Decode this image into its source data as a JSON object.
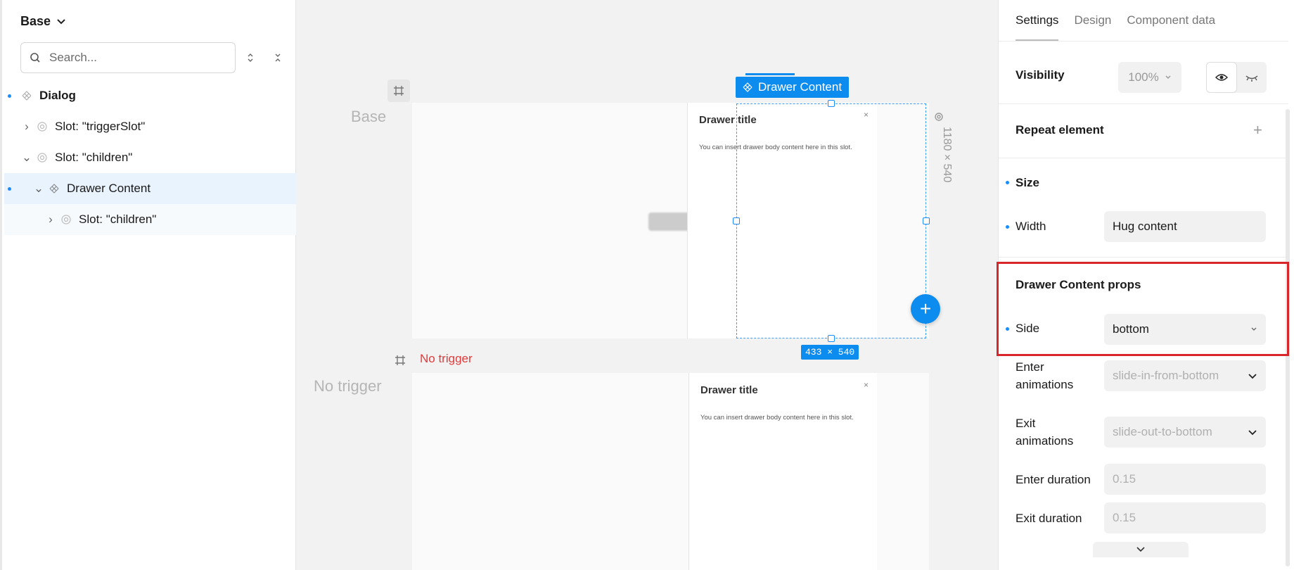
{
  "left_panel": {
    "variant": "Base",
    "search_placeholder": "Search...",
    "tree": [
      {
        "label": "Dialog"
      },
      {
        "label": "Slot: \"triggerSlot\""
      },
      {
        "label": "Slot: \"children\""
      },
      {
        "label": "Drawer Content"
      },
      {
        "label": "Slot: \"children\""
      }
    ]
  },
  "canvas": {
    "frames": [
      {
        "label": "Base"
      },
      {
        "label": "No trigger",
        "warning": "No trigger"
      }
    ],
    "selection_label": "Drawer Content",
    "selection_size": "433 × 540",
    "viewport_size": "1180 × 540",
    "drawer_title": "Drawer title",
    "drawer_body": "You can insert drawer body content here in this slot."
  },
  "right_panel": {
    "tabs": [
      "Settings",
      "Design",
      "Component data"
    ],
    "visibility": {
      "label": "Visibility",
      "opacity": "100%"
    },
    "repeat_element": "Repeat element",
    "size_section": "Size",
    "width": {
      "label": "Width",
      "value": "Hug content"
    },
    "props_section": "Drawer Content props",
    "side": {
      "label": "Side",
      "value": "bottom"
    },
    "enter_animations": {
      "label_line1": "Enter",
      "label_line2": "animations",
      "value": "slide-in-from-bottom"
    },
    "exit_animations": {
      "label_line1": "Exit",
      "label_line2": "animations",
      "value": "slide-out-to-bottom"
    },
    "enter_duration": {
      "label": "Enter duration",
      "value": "0.15"
    },
    "exit_duration": {
      "label": "Exit duration",
      "value": "0.15"
    }
  },
  "colors": {
    "accent": "#0d8cf0",
    "highlight": "#d9262b",
    "warning": "#e23b3b"
  }
}
